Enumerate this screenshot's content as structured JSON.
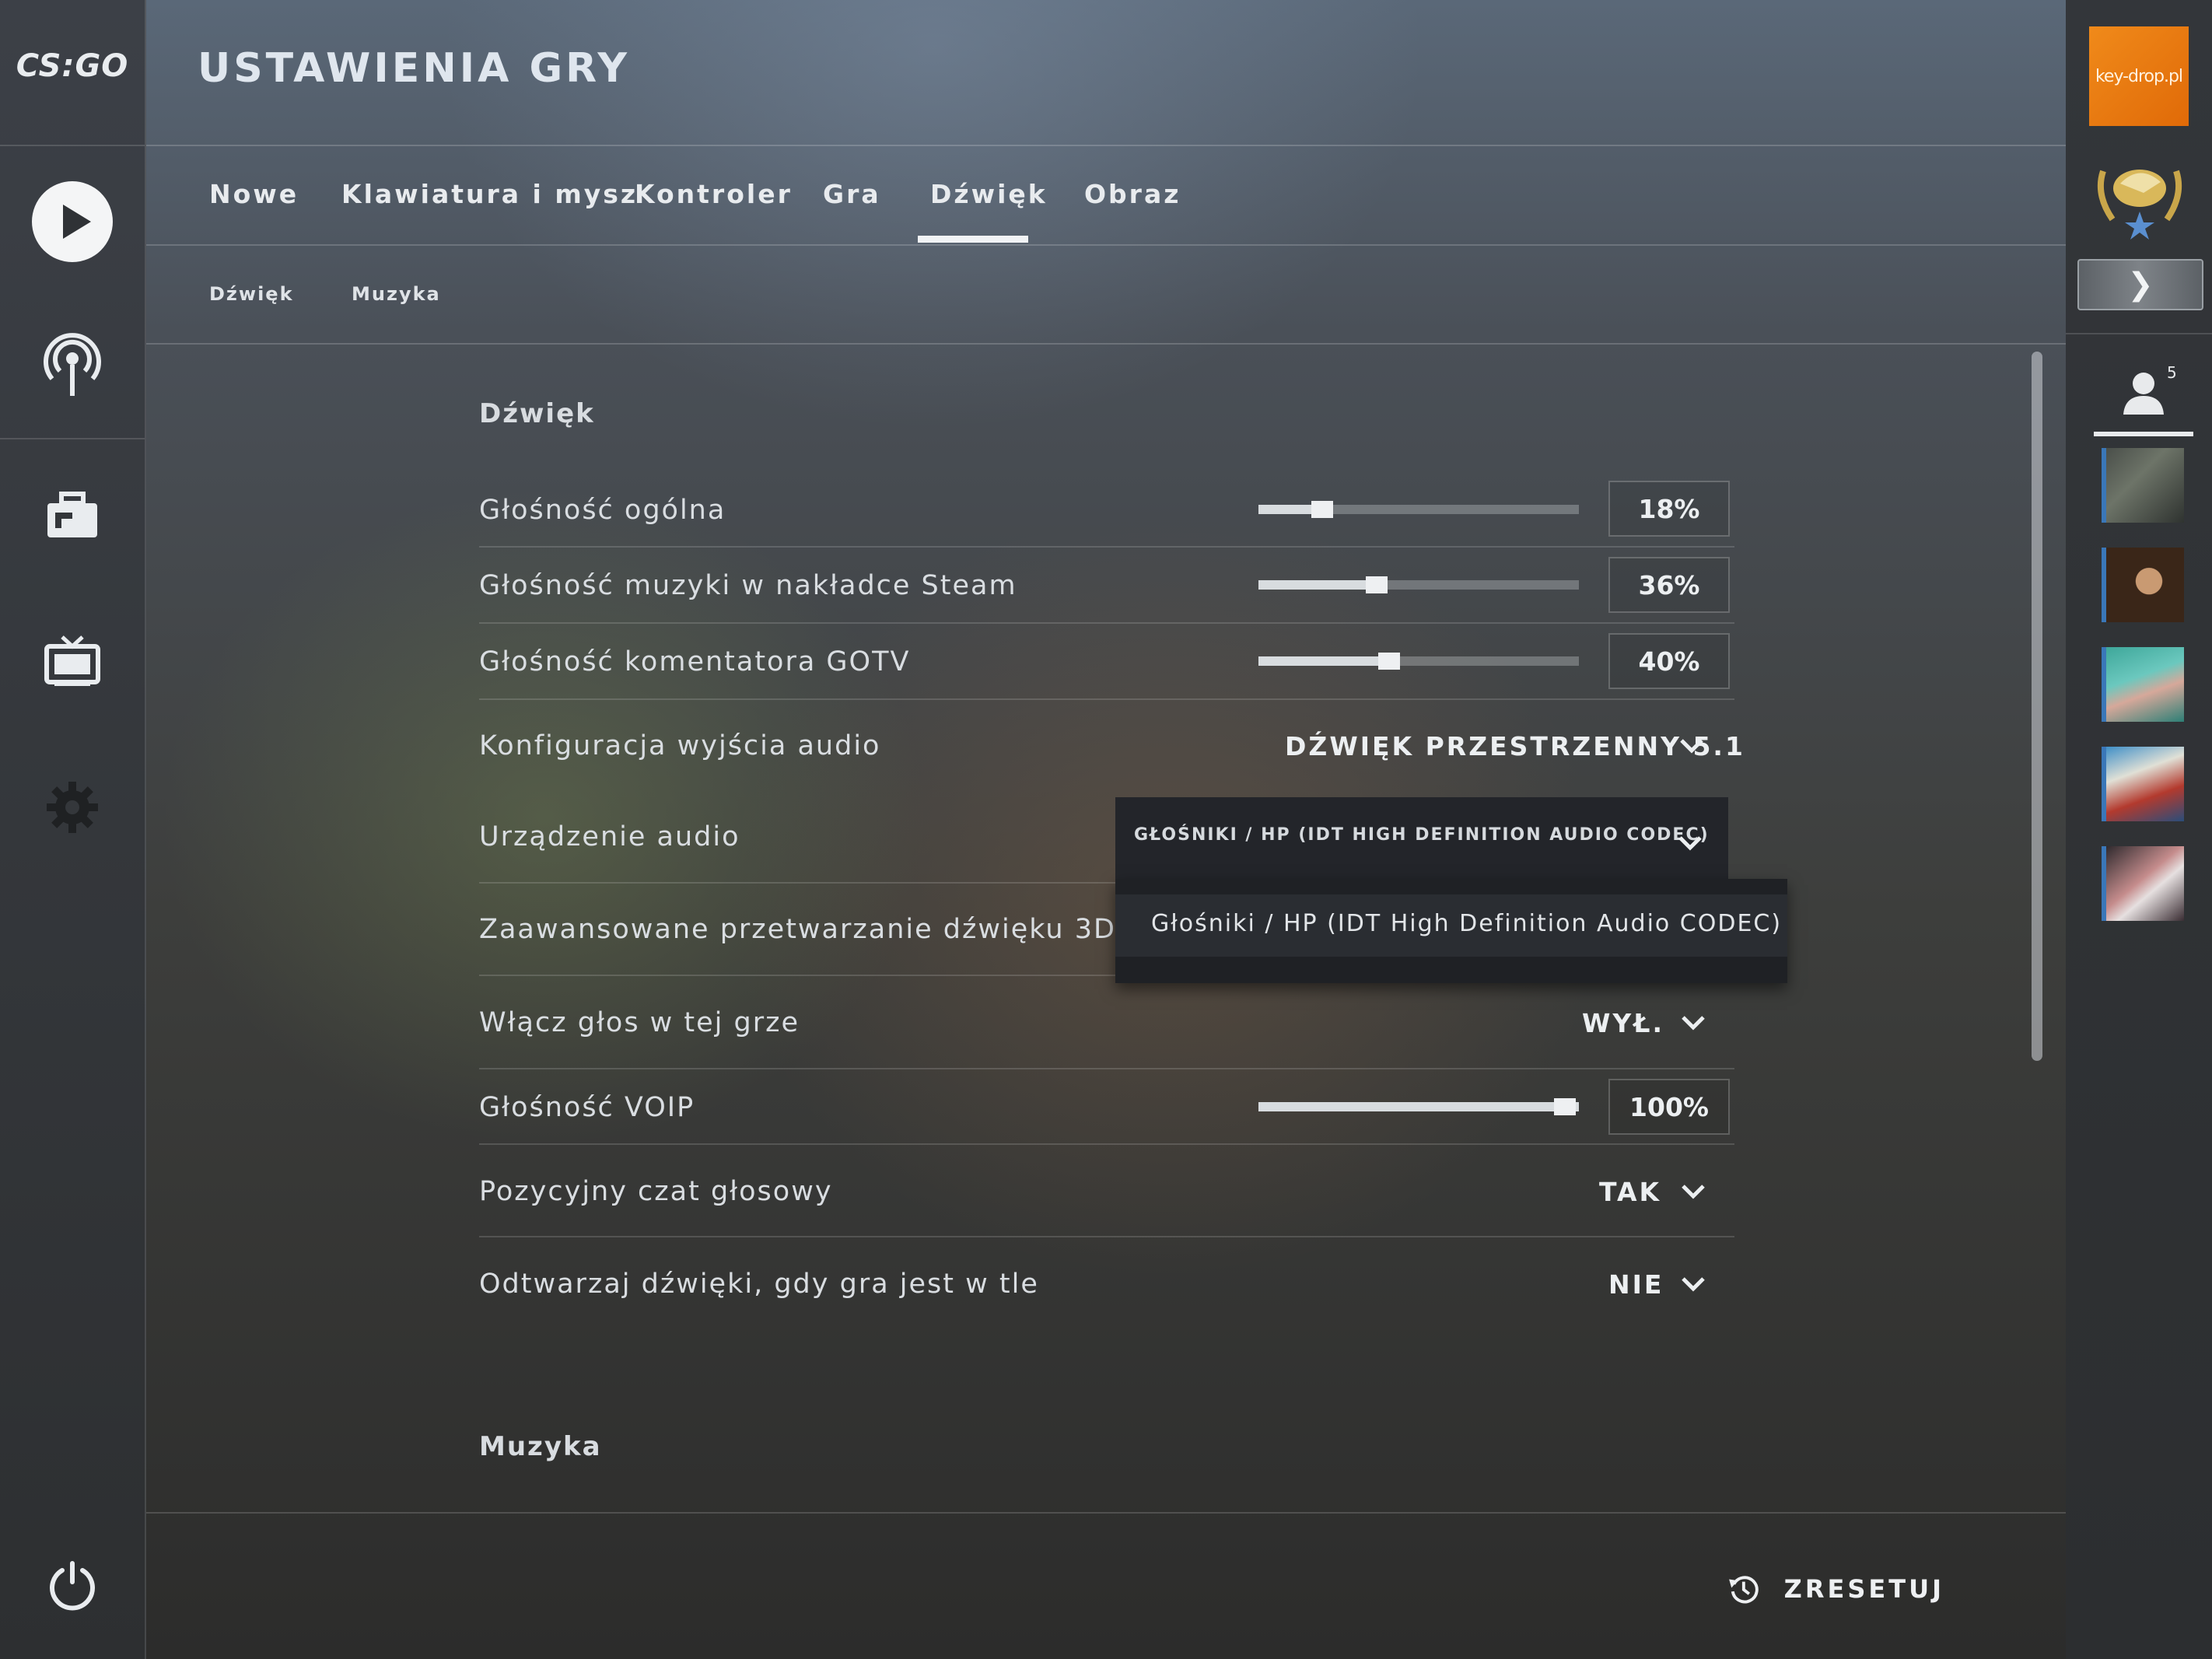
{
  "sidebar_left": {
    "logo": "CS:GO",
    "items": [
      {
        "name": "play-icon"
      },
      {
        "name": "broadcast-icon"
      },
      {
        "name": "inventory-icon"
      },
      {
        "name": "watch-icon"
      },
      {
        "name": "settings-icon"
      },
      {
        "name": "power-icon"
      }
    ]
  },
  "header": {
    "title": "USTAWIENIA GRY"
  },
  "tabs": [
    "Nowe",
    "Klawiatura i mysz",
    "Kontroler",
    "Gra",
    "Dźwięk",
    "Obraz"
  ],
  "active_tab": "Dźwięk",
  "subtabs": [
    "Dźwięk",
    "Muzyka"
  ],
  "sections": {
    "sound": {
      "title": "Dźwięk",
      "rows": [
        {
          "label": "Głośność ogólna",
          "type": "slider",
          "value": "18%",
          "level": 0.18
        },
        {
          "label": "Głośność muzyki w nakładce Steam",
          "type": "slider",
          "value": "36%",
          "level": 0.36
        },
        {
          "label": "Głośność komentatora GOTV",
          "type": "slider",
          "value": "40%",
          "level": 0.4
        },
        {
          "label": "Konfiguracja wyjścia audio",
          "type": "dropdown",
          "value": "DŹWIĘK PRZESTRZENNY 5.1"
        },
        {
          "label": "Urządzenie audio",
          "type": "dropdown-open",
          "value": "GŁOŚNIKI / HP (IDT HIGH DEFINITION AUDIO CODEC)"
        },
        {
          "label": "Zaawansowane przetwarzanie dźwięku 3D",
          "type": "dropdown",
          "value": ""
        },
        {
          "label": "Włącz głos w tej grze",
          "type": "dropdown",
          "value": "WYŁ."
        },
        {
          "label": "Głośność VOIP",
          "type": "slider",
          "value": "100%",
          "level": 1.0
        },
        {
          "label": "Pozycyjny czat głosowy",
          "type": "dropdown",
          "value": "TAK"
        },
        {
          "label": "Odtwarzaj dźwięki, gdy gra jest w tle",
          "type": "dropdown",
          "value": "NIE"
        }
      ]
    },
    "music": {
      "title": "Muzyka"
    }
  },
  "audio_device_menu": {
    "options": [
      "Głośniki / HP (IDT High Definition Audio CODEC)"
    ]
  },
  "footer": {
    "reset_label": "ZRESETUJ"
  },
  "sidebar_right": {
    "sponsor_text": "key-drop.pl",
    "friends_count": "5",
    "friend_avatars": 5
  },
  "colors": {
    "accent": "#f1f3f5",
    "sponsor": "#f08a1a",
    "friend_border": "#3a77b8"
  }
}
